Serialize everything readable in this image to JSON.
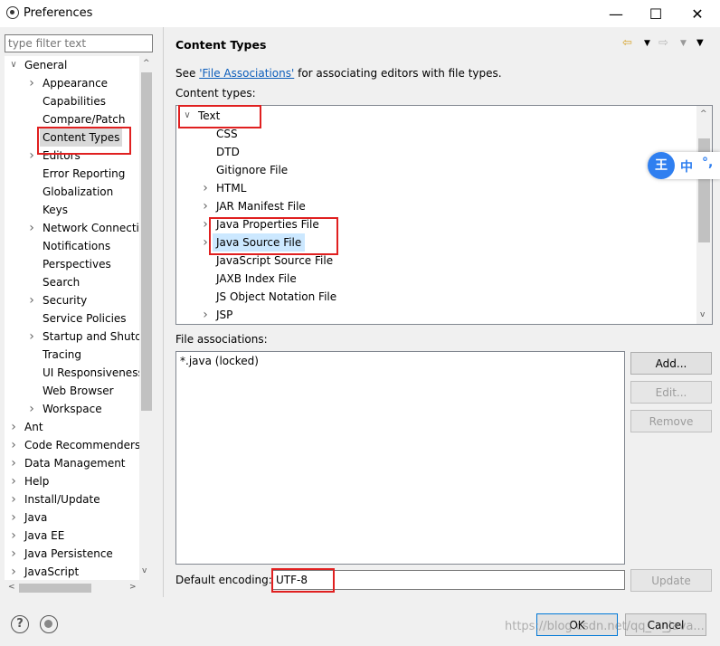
{
  "window": {
    "title": "Preferences",
    "minimize": "—",
    "maximize": "☐",
    "close": "✕"
  },
  "filter": {
    "placeholder": "type filter text"
  },
  "tree": [
    {
      "label": "General",
      "level": 0,
      "chevron": "v"
    },
    {
      "label": "Appearance",
      "level": 1,
      "chevron": ">"
    },
    {
      "label": "Capabilities",
      "level": 1,
      "chevron": ""
    },
    {
      "label": "Compare/Patch",
      "level": 1,
      "chevron": ""
    },
    {
      "label": "Content Types",
      "level": 1,
      "chevron": "",
      "selected": true
    },
    {
      "label": "Editors",
      "level": 1,
      "chevron": ">"
    },
    {
      "label": "Error Reporting",
      "level": 1,
      "chevron": ""
    },
    {
      "label": "Globalization",
      "level": 1,
      "chevron": ""
    },
    {
      "label": "Keys",
      "level": 1,
      "chevron": ""
    },
    {
      "label": "Network Connecti",
      "level": 1,
      "chevron": ">"
    },
    {
      "label": "Notifications",
      "level": 1,
      "chevron": ""
    },
    {
      "label": "Perspectives",
      "level": 1,
      "chevron": ""
    },
    {
      "label": "Search",
      "level": 1,
      "chevron": ""
    },
    {
      "label": "Security",
      "level": 1,
      "chevron": ">"
    },
    {
      "label": "Service Policies",
      "level": 1,
      "chevron": ""
    },
    {
      "label": "Startup and Shutd",
      "level": 1,
      "chevron": ">"
    },
    {
      "label": "Tracing",
      "level": 1,
      "chevron": ""
    },
    {
      "label": "UI Responsiveness",
      "level": 1,
      "chevron": ""
    },
    {
      "label": "Web Browser",
      "level": 1,
      "chevron": ""
    },
    {
      "label": "Workspace",
      "level": 1,
      "chevron": ">"
    },
    {
      "label": "Ant",
      "level": 0,
      "chevron": ">"
    },
    {
      "label": "Code Recommenders",
      "level": 0,
      "chevron": ">"
    },
    {
      "label": "Data Management",
      "level": 0,
      "chevron": ">"
    },
    {
      "label": "Help",
      "level": 0,
      "chevron": ">"
    },
    {
      "label": "Install/Update",
      "level": 0,
      "chevron": ">"
    },
    {
      "label": "Java",
      "level": 0,
      "chevron": ">"
    },
    {
      "label": "Java EE",
      "level": 0,
      "chevron": ">"
    },
    {
      "label": "Java Persistence",
      "level": 0,
      "chevron": ">"
    },
    {
      "label": "JavaScript",
      "level": 0,
      "chevron": ">"
    }
  ],
  "page": {
    "title": "Content Types",
    "see_prefix": "See ",
    "see_link": "'File Associations'",
    "see_suffix": " for associating editors with file types.",
    "content_types_label": "Content types:",
    "content_types": [
      {
        "label": "Text",
        "level": 0,
        "chevron": "v"
      },
      {
        "label": "CSS",
        "level": 1,
        "chevron": ""
      },
      {
        "label": "DTD",
        "level": 1,
        "chevron": ""
      },
      {
        "label": "Gitignore File",
        "level": 1,
        "chevron": ""
      },
      {
        "label": "HTML",
        "level": 1,
        "chevron": ">"
      },
      {
        "label": "JAR Manifest File",
        "level": 1,
        "chevron": ">"
      },
      {
        "label": "Java Properties File",
        "level": 1,
        "chevron": ">"
      },
      {
        "label": "Java Source File",
        "level": 1,
        "chevron": ">",
        "selected": true
      },
      {
        "label": "JavaScript Source File",
        "level": 1,
        "chevron": ""
      },
      {
        "label": "JAXB Index File",
        "level": 1,
        "chevron": ""
      },
      {
        "label": "JS Object Notation File",
        "level": 1,
        "chevron": ""
      },
      {
        "label": "JSP",
        "level": 1,
        "chevron": ">"
      }
    ],
    "file_assoc_label": "File associations:",
    "file_associations": [
      "*.java (locked)"
    ],
    "add_button": "Add...",
    "edit_button": "Edit...",
    "remove_button": "Remove",
    "encoding_label": "Default encoding:",
    "encoding_value": "UTF-8",
    "update_button": "Update"
  },
  "ime": {
    "logo": "王",
    "mode": "中",
    "punct": "°,"
  },
  "dialog": {
    "ok_button": "OK",
    "cancel_button": "Cancel"
  },
  "watermark": "https://blog.csdn.net/qq_..._Java..."
}
